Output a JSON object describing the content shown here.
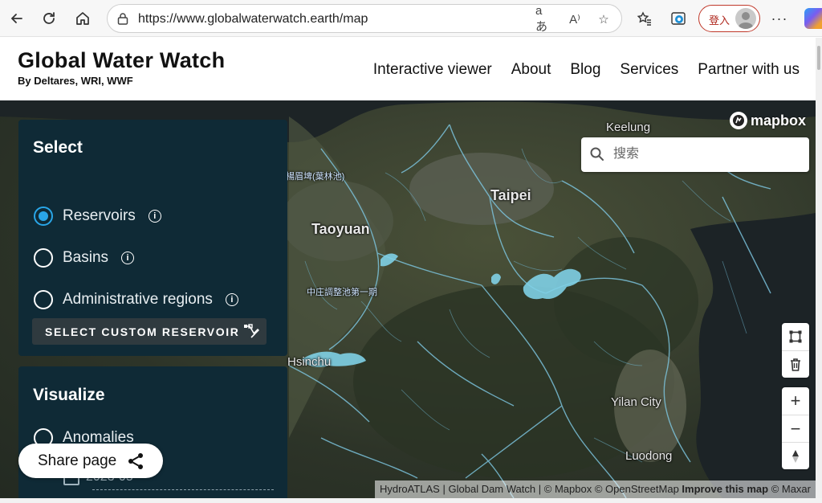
{
  "browser": {
    "url": "https://www.globalwaterwatch.earth/map",
    "signin_label": "登入",
    "icons": [
      "back-icon",
      "reload-icon",
      "home-icon",
      "lock-icon",
      "translate-icon",
      "read-aloud-icon",
      "favorite-icon",
      "favorites-list-icon",
      "edge-browser-icon",
      "more-icon",
      "copilot-icon"
    ]
  },
  "header": {
    "title": "Global Water Watch",
    "subtitle": "By Deltares, WRI, WWF",
    "nav": [
      "Interactive viewer",
      "About",
      "Blog",
      "Services",
      "Partner with us"
    ]
  },
  "map": {
    "provider": "mapbox",
    "search_placeholder": "搜索",
    "labels": {
      "keelung": "Keelung",
      "taipei": "Taipei",
      "taoyuan": "Taoyuan",
      "reservoir1": "楊眉埤(葉林池)",
      "reservoir2": "中庄調整池第一期",
      "hsinchu": "Hsinchu",
      "yilan": "Yilan City",
      "luodong": "Luodong"
    },
    "controls": {
      "draw": "draw-polygon-icon",
      "trash": "trash-icon",
      "zoom_in": "+",
      "zoom_out": "−",
      "compass": "compass-icon"
    },
    "attribution": {
      "hydro": "HydroATLAS",
      "sep": "|",
      "dam": "Global Dam Watch",
      "mapbox": "© Mapbox",
      "osm": "© OpenStreetMap",
      "improve": "Improve this map",
      "maxar": "© Maxar"
    },
    "colors": {
      "water": "#7ec8e3",
      "panel": "#0f2a36",
      "accent": "#29a6e8"
    }
  },
  "select_panel": {
    "title": "Select",
    "options": [
      {
        "label": "Reservoirs",
        "checked": true
      },
      {
        "label": "Basins",
        "checked": false
      },
      {
        "label": "Administrative regions",
        "checked": false
      }
    ],
    "custom_button": "SELECT CUSTOM RESERVOIR"
  },
  "visualize_panel": {
    "title": "Visualize",
    "option": "Anomalies",
    "date_partial": "2023-05"
  },
  "share": {
    "label": "Share page"
  }
}
